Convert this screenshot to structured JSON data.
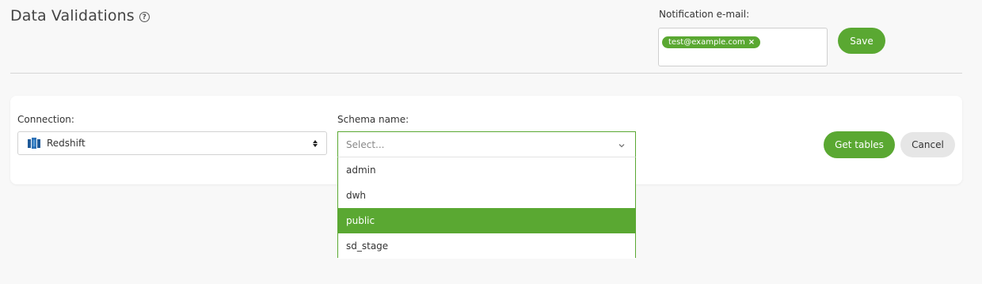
{
  "header": {
    "title": "Data Validations",
    "help_icon": "?"
  },
  "notification": {
    "label": "Notification e-mail:",
    "emails": [
      "test@example.com"
    ],
    "remove_glyph": "×",
    "save_label": "Save"
  },
  "form": {
    "connection_label": "Connection:",
    "connection_value": "Redshift",
    "connection_icon": "redshift-icon",
    "schema_label": "Schema name:",
    "schema_placeholder": "Select...",
    "schema_options": [
      "admin",
      "dwh",
      "public",
      "sd_stage"
    ],
    "schema_highlighted": "public",
    "get_tables_label": "Get tables",
    "cancel_label": "Cancel"
  },
  "colors": {
    "accent": "#5aa832",
    "background": "#f8f8f8",
    "card": "#ffffff",
    "cancel_bg": "#e6e6e6"
  }
}
